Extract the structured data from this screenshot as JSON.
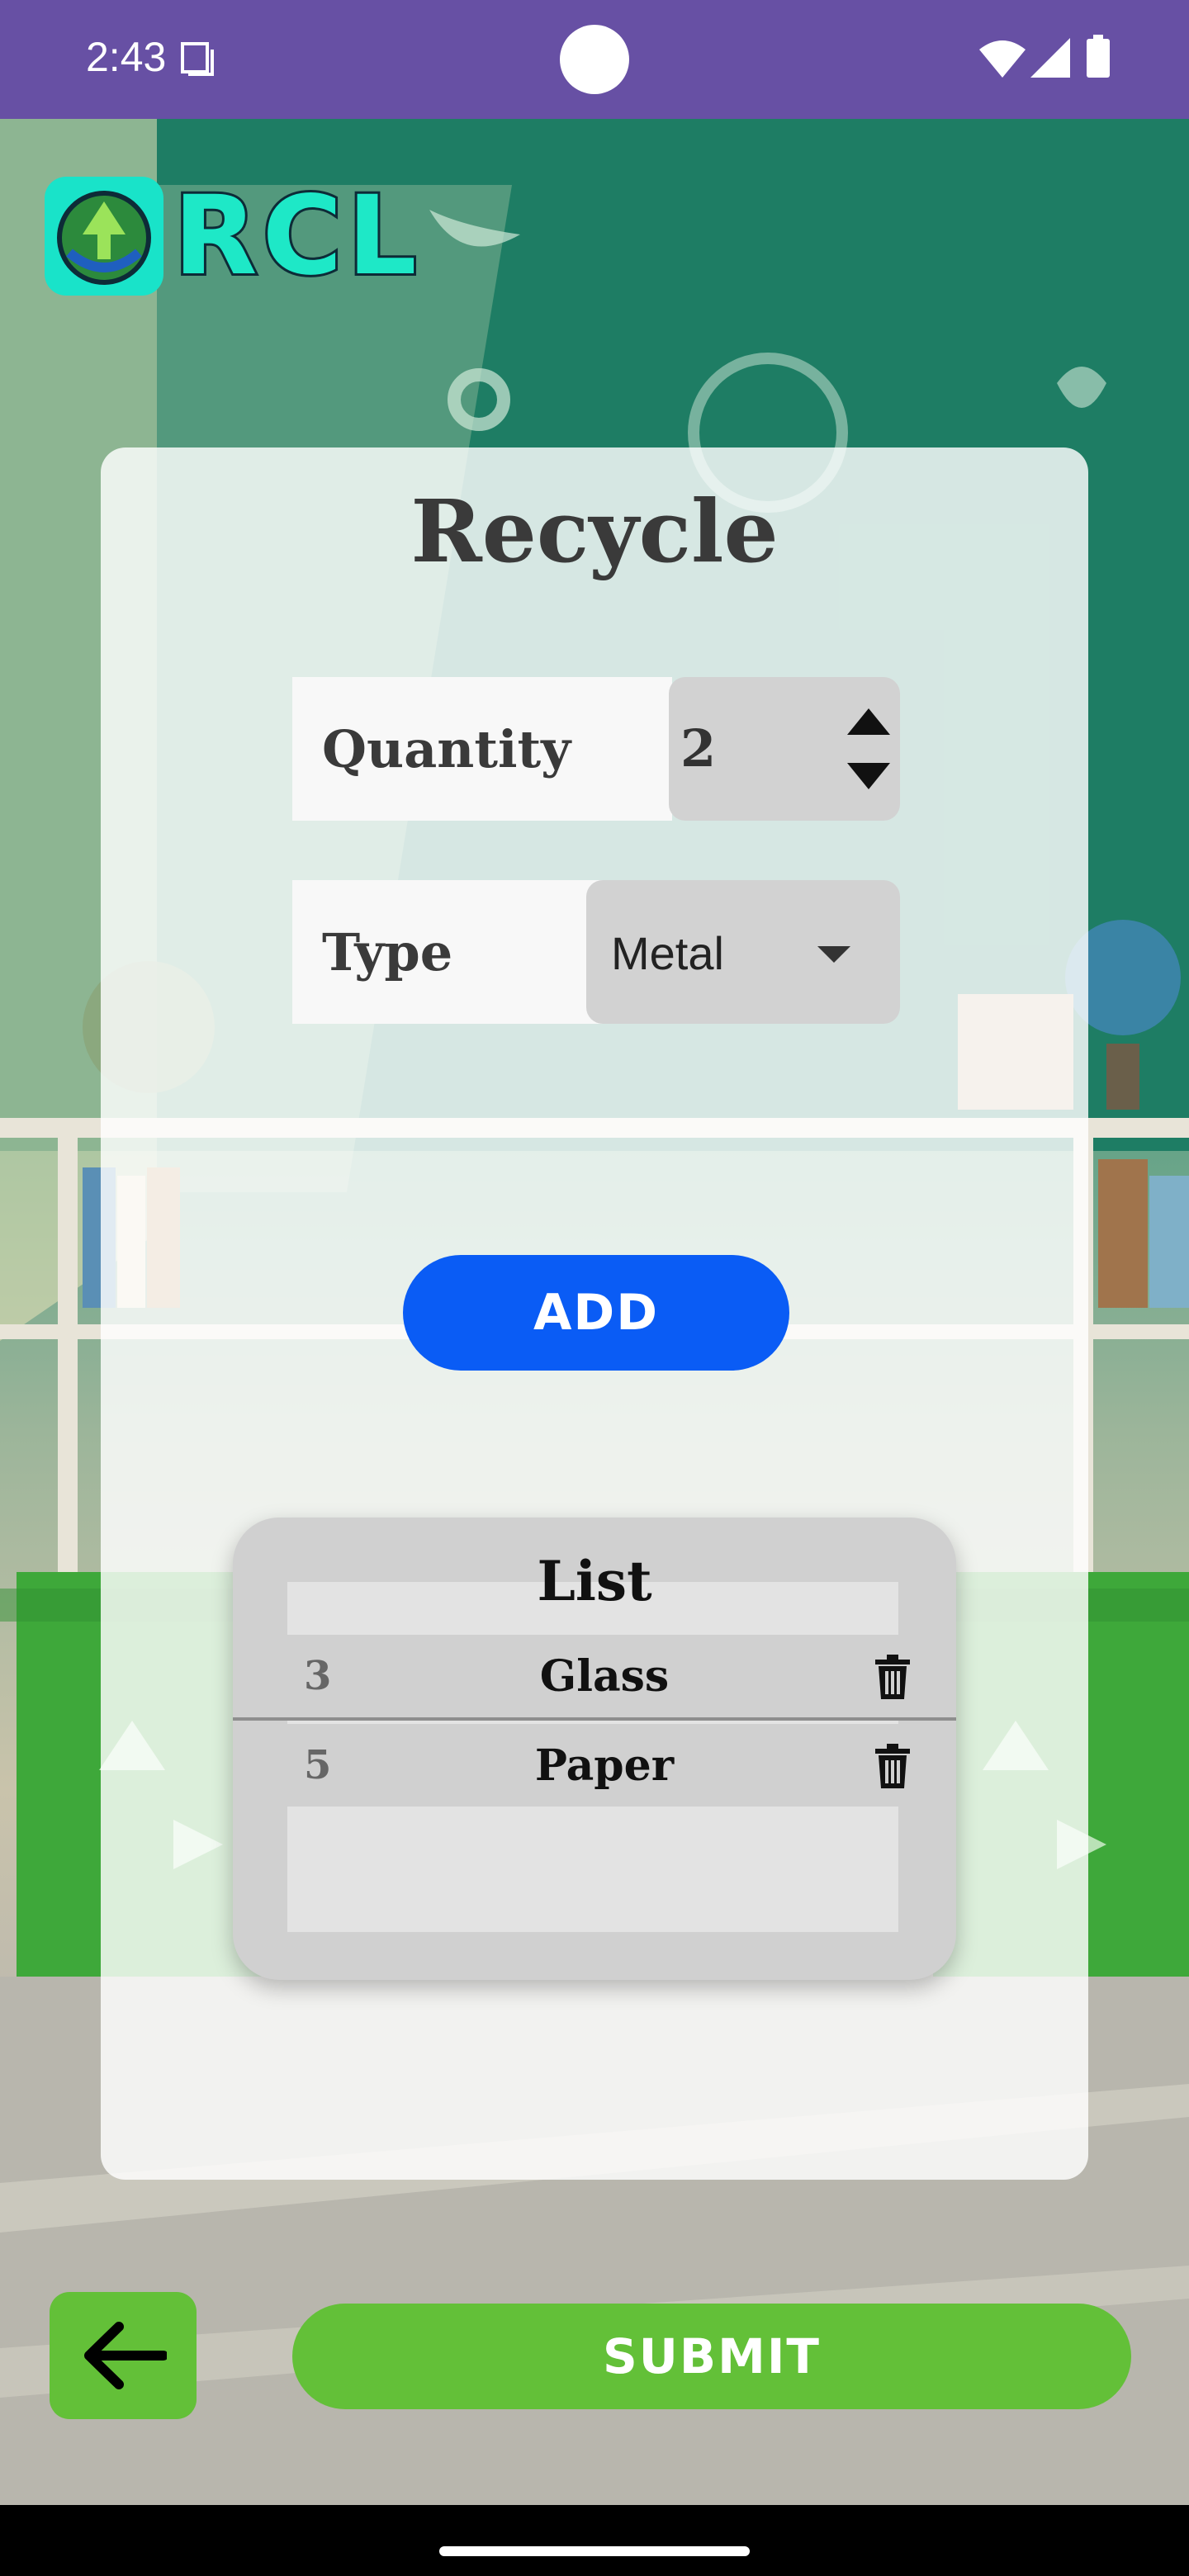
{
  "status_bar": {
    "time": "2:43",
    "icons": [
      "sim-card-icon",
      "wifi-icon",
      "signal-icon",
      "battery-icon"
    ]
  },
  "logo": {
    "text": "RCL"
  },
  "form": {
    "title": "Recycle",
    "quantity_label": "Quantity",
    "quantity_value": "2",
    "type_label": "Type",
    "type_selected": "Metal",
    "add_label": "ADD"
  },
  "list": {
    "title": "List",
    "items": [
      {
        "quantity": "3",
        "type": "Glass"
      },
      {
        "quantity": "5",
        "type": "Paper"
      }
    ]
  },
  "actions": {
    "submit_label": "SUBMIT"
  },
  "colors": {
    "status_bar": "#6750a4",
    "add_button": "#0a5cf5",
    "submit_button": "#63c038",
    "logo_accent": "#1ee8c7"
  }
}
